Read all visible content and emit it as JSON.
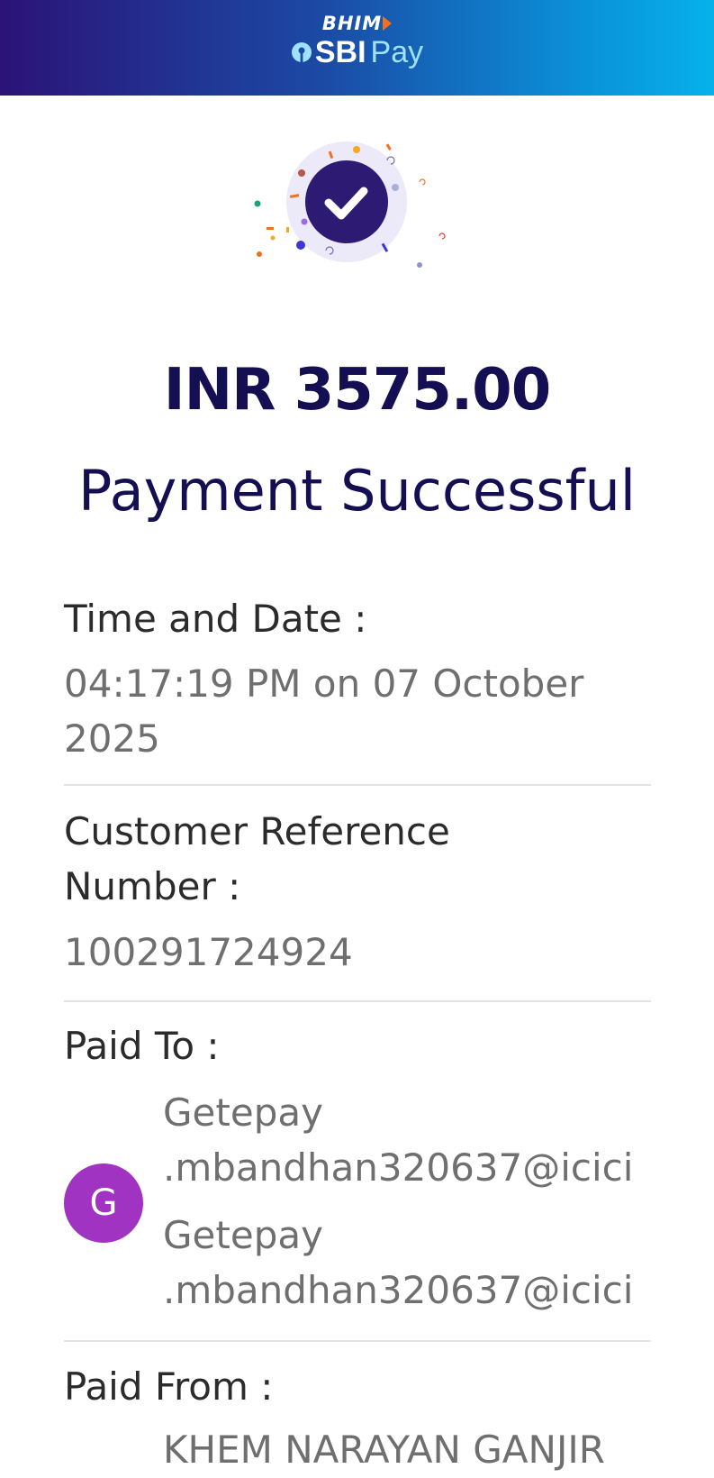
{
  "header": {
    "bhim_text": "BHIM",
    "sbi_text": "SBI",
    "pay_text": "Pay"
  },
  "success_icon": "check-circle-icon",
  "amount": "INR 3575.00",
  "status": "Payment Successful",
  "details": {
    "time_label": "Time and Date :",
    "time_value_line1": "04:17:19 PM on 07 October",
    "time_value_line2": "2025",
    "ref_label_line1": "Customer Reference",
    "ref_label_line2": "Number :",
    "ref_value": "100291724924",
    "paid_to_label": "Paid To :",
    "payee_avatar": "G",
    "payee_name_line1": "Getepay",
    "payee_name_line2": ".mbandhan320637@icici",
    "payee_vpa_line1": "Getepay",
    "payee_vpa_line2": ".mbandhan320637@icici",
    "paid_from_label": "Paid From :",
    "payer_partial": "KHEM NARAYAN GANJIR"
  },
  "colors": {
    "header_start": "#2b1378",
    "header_end": "#06b1ea",
    "amount_text": "#130f52",
    "avatar_bg": "#a033c1",
    "check_circle": "#2d1a73"
  }
}
